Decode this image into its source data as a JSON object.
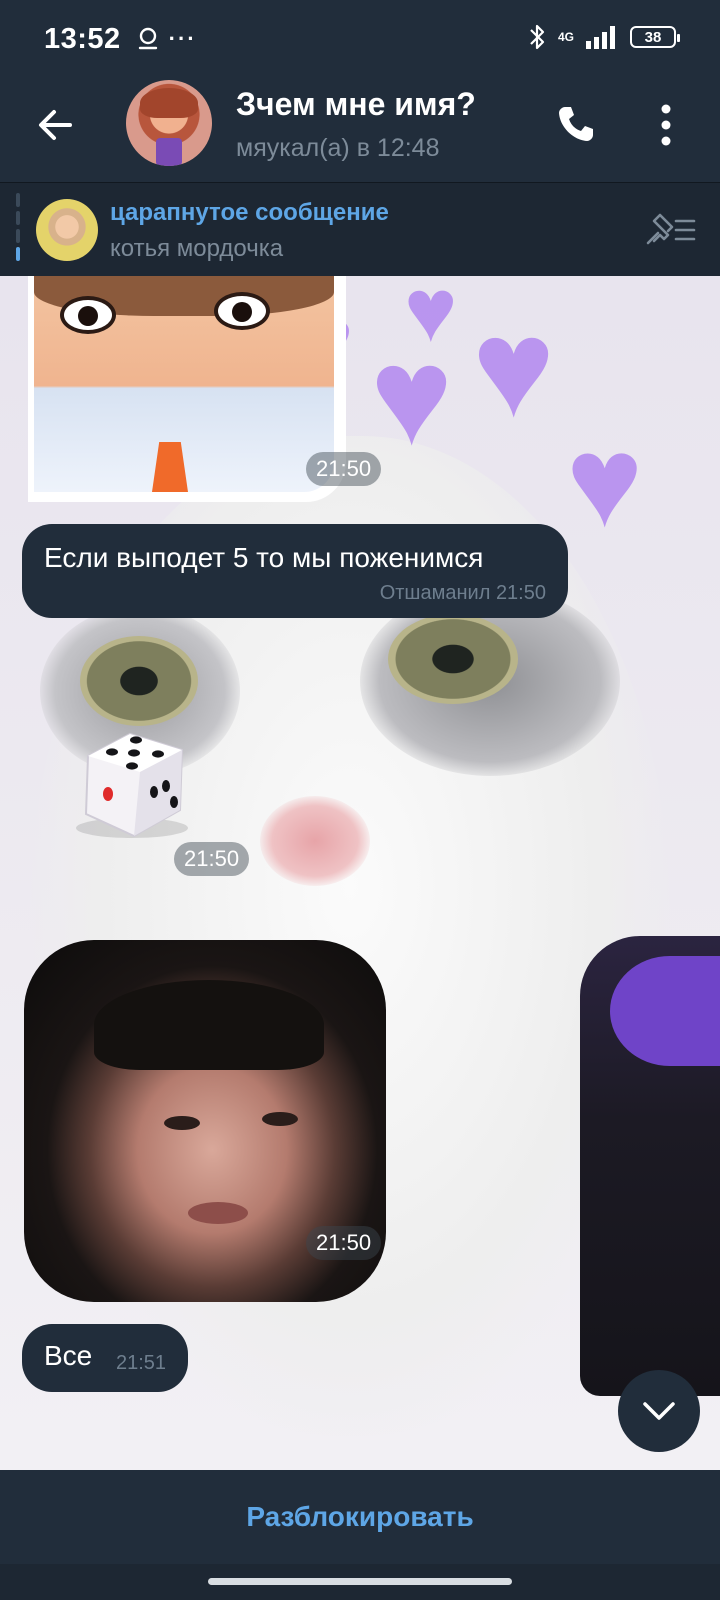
{
  "status_bar": {
    "time": "13:52",
    "dots": "···",
    "network": "4G",
    "battery": "38"
  },
  "header": {
    "title": "Зчем мне имя?",
    "subtitle": "мяукал(а) в 12:48"
  },
  "pinned": {
    "title": "царапнутое сообщение",
    "text": "котья мордочка"
  },
  "messages": {
    "sticker_time": "21:50",
    "text_message": {
      "text": "Если выподет 5 то мы поженимся",
      "author": "Отшаманил",
      "time": "21:50"
    },
    "dice": {
      "value": 5,
      "time": "21:50"
    },
    "video_time": "21:50",
    "last_message": {
      "text": "Все",
      "time": "21:51"
    }
  },
  "bottom": {
    "unblock_label": "Разблокировать"
  },
  "colors": {
    "accent": "#5ea6e6",
    "bubble": "#212d3b",
    "header_bg": "#212d3b"
  },
  "icons": [
    "location-icon",
    "bluetooth-icon",
    "signal-icon",
    "back-arrow-icon",
    "phone-icon",
    "more-vert-icon",
    "pin-list-icon",
    "chevron-down-icon"
  ]
}
